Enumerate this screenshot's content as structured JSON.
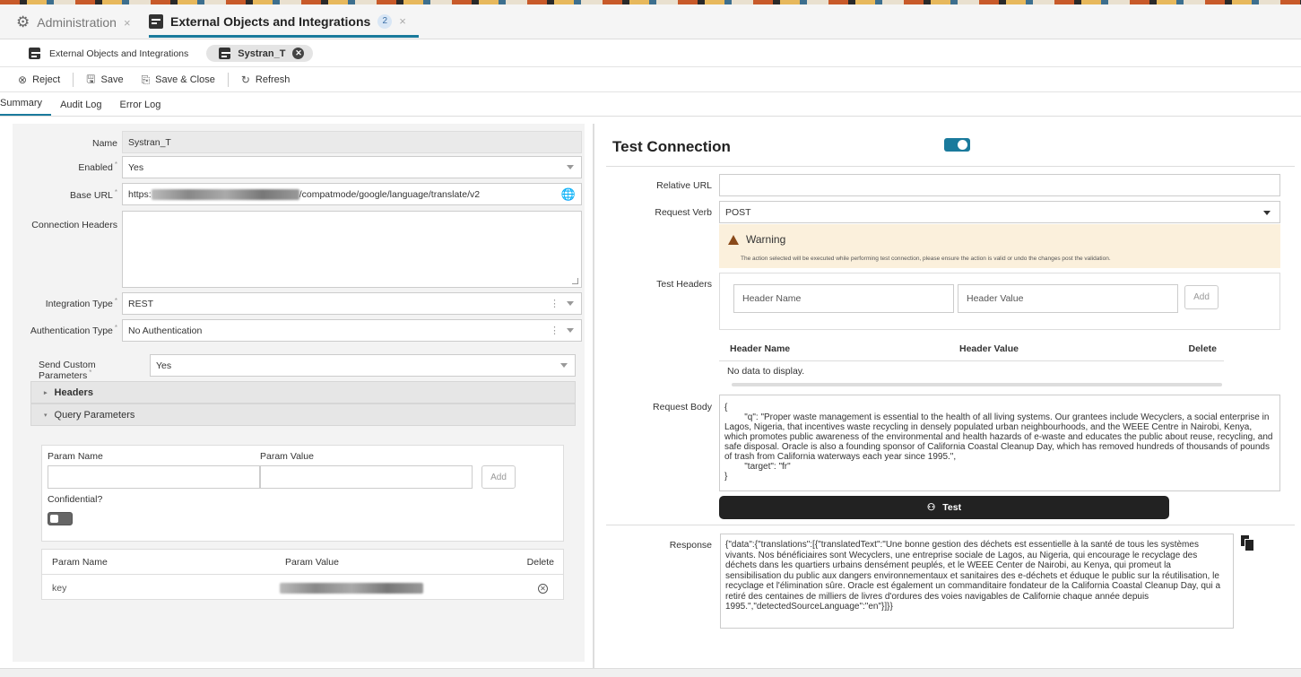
{
  "tabs": {
    "admin_label": "Administration",
    "ext_label": "External Objects and Integrations",
    "ext_badge": "2",
    "close_glyph": "×"
  },
  "breadcrumb": {
    "parent": "External Objects and Integrations",
    "current": "Systran_T"
  },
  "toolbar": {
    "reject": "Reject",
    "save": "Save",
    "save_close": "Save & Close",
    "refresh": "Refresh"
  },
  "subtabs": [
    "Summary",
    "Audit Log",
    "Error Log"
  ],
  "form": {
    "name_label": "Name",
    "name_value": "Systran_T",
    "enabled_label": "Enabled",
    "enabled_value": "Yes",
    "base_url_label": "Base URL",
    "base_url_prefix": "https:",
    "base_url_suffix": "/compatmode/google/language/translate/v2",
    "conn_headers_label": "Connection Headers",
    "integration_type_label": "Integration Type",
    "integration_type_value": "REST",
    "auth_type_label": "Authentication Type",
    "auth_type_value": "No Authentication",
    "send_custom_label": "Send Custom Parameters",
    "send_custom_value": "Yes",
    "headers_section": "Headers",
    "query_section": "Query Parameters",
    "param_name_label": "Param Name",
    "param_value_label": "Param Value",
    "add_label": "Add",
    "confidential_label": "Confidential?",
    "table": {
      "col_name": "Param Name",
      "col_value": "Param Value",
      "col_delete": "Delete",
      "rows": [
        {
          "name": "key"
        }
      ]
    }
  },
  "test": {
    "title": "Test Connection",
    "relative_url_label": "Relative URL",
    "request_verb_label": "Request Verb",
    "request_verb_value": "POST",
    "warning_title": "Warning",
    "warning_msg": "The action selected will be executed while performing test connection, please ensure the action is valid or undo the changes post the validation.",
    "test_headers_label": "Test Headers",
    "header_name_ph": "Header Name",
    "header_value_ph": "Header Value",
    "add_label": "Add",
    "col_header_name": "Header Name",
    "col_header_value": "Header Value",
    "col_delete": "Delete",
    "no_data": "No data to display.",
    "request_body_label": "Request Body",
    "request_body": "{\n        \"q\": \"Proper waste management is essential to the health of all living systems. Our grantees include Wecyclers, a social enterprise in Lagos, Nigeria, that incentives waste recycling in densely populated urban neighbourhoods, and the WEEE Centre in Nairobi, Kenya, which promotes public awareness of the environmental and health hazards of e-waste and educates the public about reuse, recycling, and safe disposal. Oracle is also a founding sponsor of California Coastal Cleanup Day, which has removed hundreds of thousands of pounds of trash from California waterways each year since 1995.\",\n        \"target\": \"fr\"\n}",
    "test_button": "Test",
    "response_label": "Response",
    "response": "{\"data\":{\"translations\":[{\"translatedText\":\"Une bonne gestion des déchets est essentielle à la santé de tous les systèmes vivants. Nos bénéficiaires sont Wecyclers, une entreprise sociale de Lagos, au Nigeria, qui encourage le recyclage des déchets dans les quartiers urbains densément peuplés, et le WEEE Center de Nairobi, au Kenya, qui promeut la sensibilisation du public aux dangers environnementaux et sanitaires des e-déchets et éduque le public sur la réutilisation, le recyclage et l'élimination sûre. Oracle est également un commanditaire fondateur de la California Coastal Cleanup Day, qui a retiré des centaines de milliers de livres d'ordures des voies navigables de Californie chaque année depuis 1995.\",\"detectedSourceLanguage\":\"en\"}]}}"
  },
  "colors": {
    "accent": "#1a7a9c",
    "warning_bg": "#fbf0dc"
  }
}
